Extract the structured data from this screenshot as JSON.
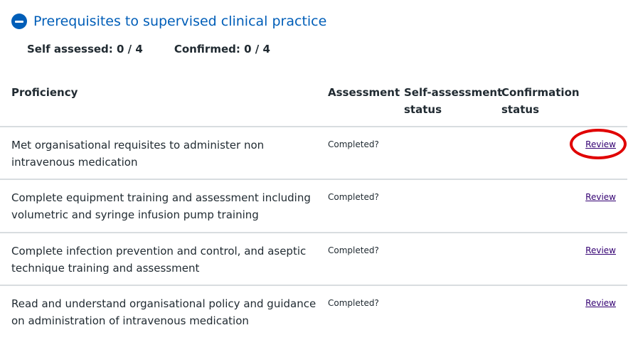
{
  "section": {
    "title": "Prerequisites to supervised clinical practice",
    "icon": "minus-circle-icon"
  },
  "summary": {
    "self_assessed": "Self assessed: 0 / 4",
    "confirmed": "Confirmed: 0 / 4"
  },
  "table": {
    "headers": {
      "proficiency": "Proficiency",
      "assessment": "Assessment",
      "self_assessment_line1": "Self-assessment",
      "self_assessment_line2": "status",
      "confirmation_line1": "Confirmation",
      "confirmation_line2": "status"
    },
    "rows": [
      {
        "proficiency_line1": "Met organisational requisites to administer non",
        "proficiency_line2": "intravenous medication",
        "assessment": "Completed?",
        "action": "Review"
      },
      {
        "proficiency_line1": "Complete equipment training and assessment including",
        "proficiency_line2": "volumetric and syringe infusion pump training",
        "assessment": "Completed?",
        "action": "Review"
      },
      {
        "proficiency_line1": "Complete infection prevention and control, and aseptic",
        "proficiency_line2": "technique training and assessment",
        "assessment": "Completed?",
        "action": "Review"
      },
      {
        "proficiency_line1": "Read and understand organisational policy and guidance",
        "proficiency_line2": "on administration of intravenous medication",
        "assessment": "Completed?",
        "action": "Review"
      }
    ]
  },
  "colors": {
    "accent": "#005eb8",
    "link": "#330072",
    "annotation": "#e00000",
    "divider": "#d8dde0"
  }
}
